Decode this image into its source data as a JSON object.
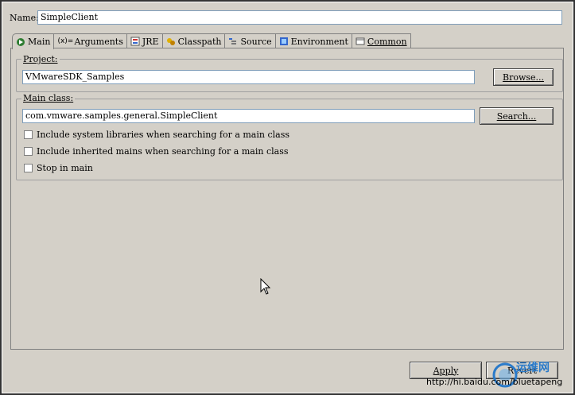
{
  "name": {
    "label": "Name:",
    "value": "SimpleClient"
  },
  "tabs": [
    {
      "label": "Main",
      "icon": "main-tab-icon",
      "active": true
    },
    {
      "label": "Arguments",
      "icon": "arguments-icon"
    },
    {
      "label": "JRE",
      "icon": "jre-icon"
    },
    {
      "label": "Classpath",
      "icon": "classpath-icon"
    },
    {
      "label": "Source",
      "icon": "source-icon"
    },
    {
      "label": "Environment",
      "icon": "environment-icon"
    },
    {
      "label": "Common",
      "icon": "common-icon"
    }
  ],
  "project": {
    "title": "Project:",
    "value": "VMwareSDK_Samples",
    "browse_label": "Browse..."
  },
  "main_class": {
    "title": "Main class:",
    "value": "com.vmware.samples.general.SimpleClient",
    "search_label": "Search...",
    "options": [
      {
        "label": "Include system libraries when searching for a main class",
        "checked": false
      },
      {
        "label": "Include inherited mains when searching for a main class",
        "checked": false
      },
      {
        "label": "Stop in main",
        "checked": false
      }
    ]
  },
  "buttons": {
    "apply": "Apply",
    "revert": "Revert"
  },
  "watermark": {
    "url": "http://hi.baidu.com/bluetapeng",
    "logo_text": "运维网"
  }
}
